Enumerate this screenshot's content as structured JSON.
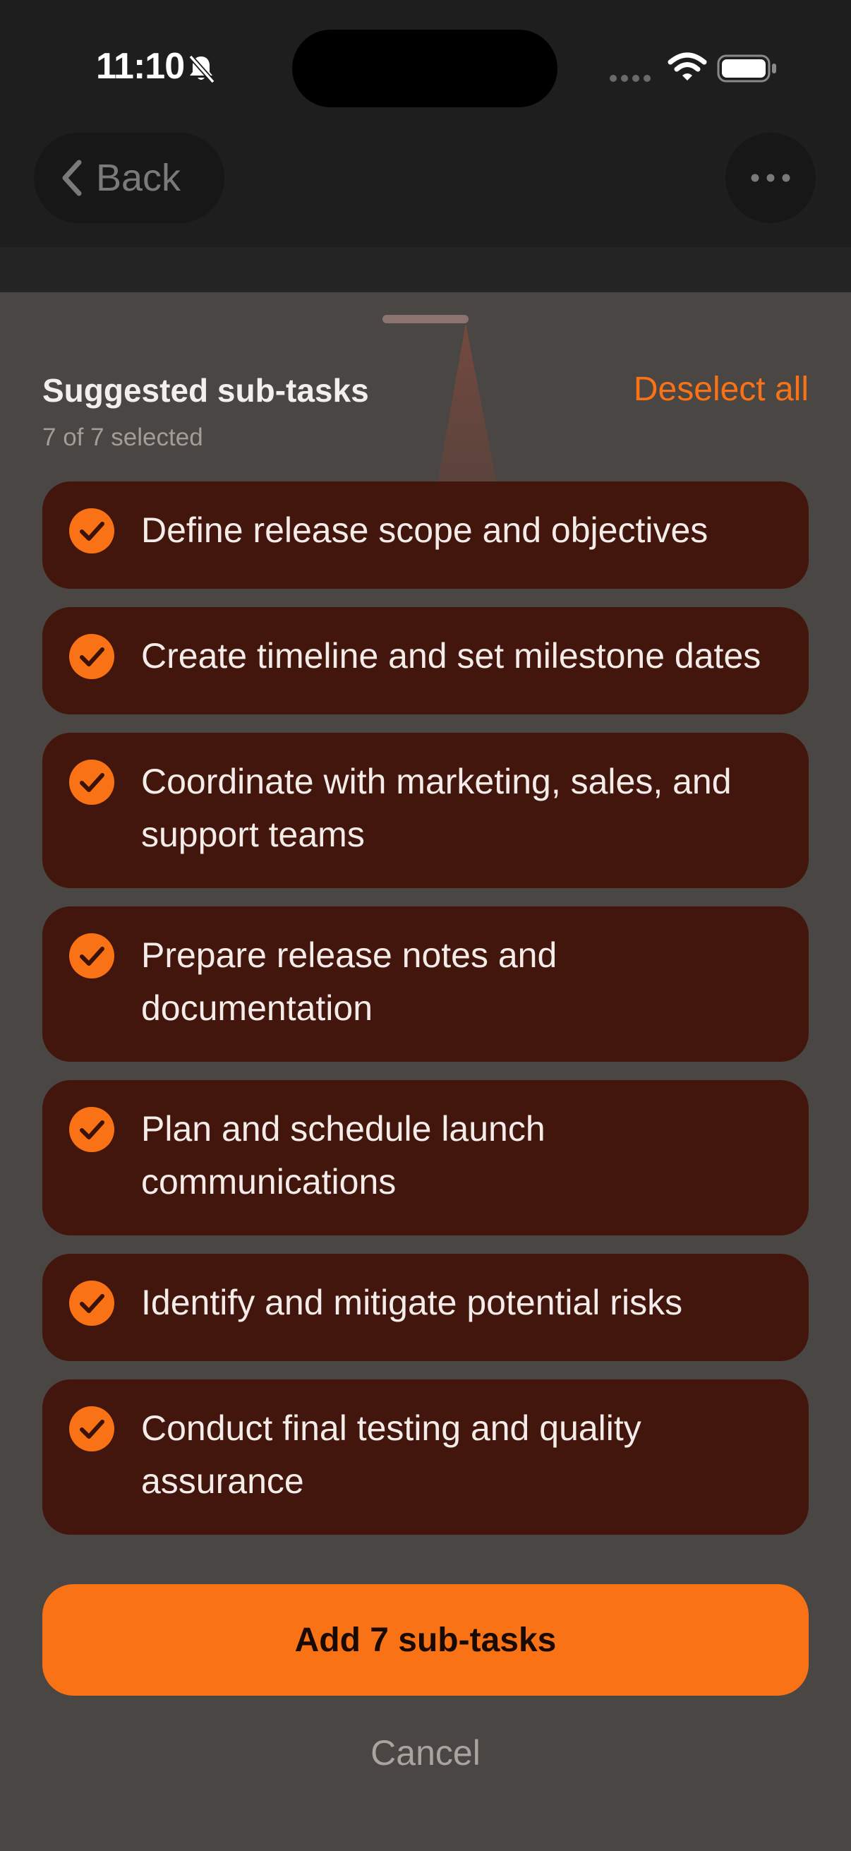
{
  "status_bar": {
    "time": "11:10"
  },
  "header": {
    "back_label": "Back"
  },
  "sheet": {
    "title": "Suggested sub-tasks",
    "subtitle": "7 of 7 selected",
    "deselect_label": "Deselect all",
    "tasks": [
      {
        "label": "Define release scope and objectives",
        "selected": true
      },
      {
        "label": "Create timeline and set milestone dates",
        "selected": true
      },
      {
        "label": "Coordinate with marketing, sales, and support teams",
        "selected": true
      },
      {
        "label": "Prepare release notes and documentation",
        "selected": true
      },
      {
        "label": "Plan and schedule launch communications",
        "selected": true
      },
      {
        "label": "Identify and mitigate potential risks",
        "selected": true
      },
      {
        "label": "Conduct final testing and quality assurance",
        "selected": true
      }
    ],
    "add_label": "Add 7 sub-tasks",
    "cancel_label": "Cancel"
  },
  "colors": {
    "accent": "#f97316",
    "task_bg": "#43160d",
    "sheet_bg": "#4a4643"
  },
  "icons": [
    "bell-slash-icon",
    "signal-dots-icon",
    "wifi-icon",
    "battery-icon",
    "chevron-left-icon",
    "ellipsis-icon",
    "check-circle-icon"
  ]
}
